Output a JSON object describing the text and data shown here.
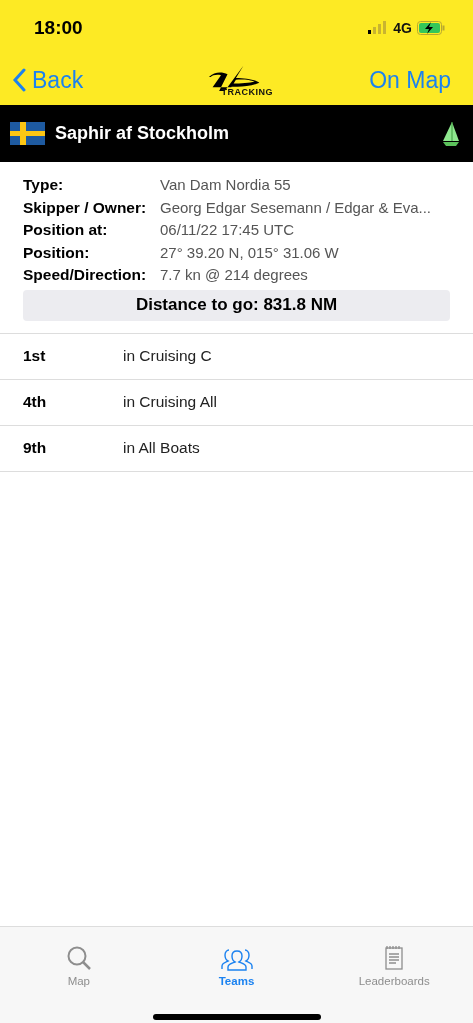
{
  "status_bar": {
    "time": "18:00",
    "network": "4G"
  },
  "nav": {
    "back": "Back",
    "logo_text": "TRACKING",
    "action": "On Map"
  },
  "boat": {
    "name": "Saphir af Stockholm"
  },
  "details": [
    {
      "label": "Type:",
      "value": "Van Dam Nordia 55"
    },
    {
      "label": "Skipper / Owner:",
      "value": "Georg Edgar Sesemann / Edgar & Eva..."
    },
    {
      "label": "Position at:",
      "value": "06/11/22 17:45 UTC"
    },
    {
      "label": "Position:",
      "value": "27° 39.20 N, 015° 31.06 W"
    },
    {
      "label": "Speed/Direction:",
      "value": "7.7 kn @ 214 degrees"
    }
  ],
  "distance": "Distance to go: 831.8 NM",
  "rankings": [
    {
      "rank": "1st",
      "division": "in Cruising C"
    },
    {
      "rank": "4th",
      "division": "in Cruising All"
    },
    {
      "rank": "9th",
      "division": "in All Boats"
    }
  ],
  "tabs": [
    {
      "label": "Map",
      "kind": "search",
      "selected": false
    },
    {
      "label": "Teams",
      "kind": "teams",
      "selected": true
    },
    {
      "label": "Leaderboards",
      "kind": "list",
      "selected": false
    }
  ]
}
